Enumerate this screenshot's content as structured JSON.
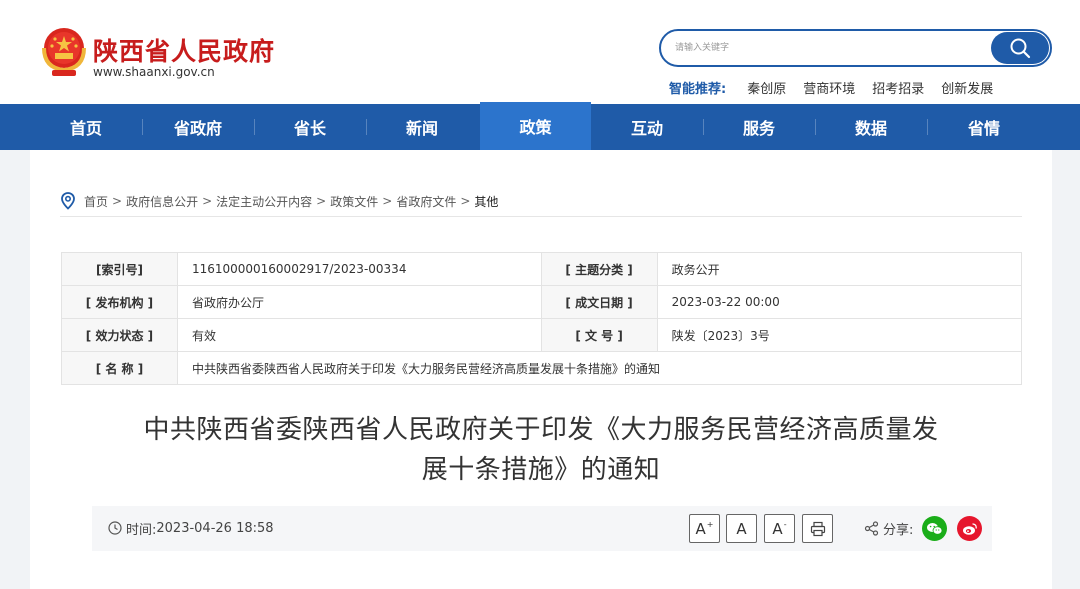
{
  "header": {
    "site_name": "陕西省人民政府",
    "site_url": "www.shaanxi.gov.cn",
    "search_placeholder": "请输入关键字",
    "recommend_label": "智能推荐:",
    "recommend_items": [
      "秦创原",
      "营商环境",
      "招考招录",
      "创新发展"
    ]
  },
  "nav": {
    "items": [
      "首页",
      "省政府",
      "省长",
      "新闻",
      "政策",
      "互动",
      "服务",
      "数据",
      "省情"
    ],
    "active": "政策"
  },
  "breadcrumb": {
    "items": [
      "首页",
      "政府信息公开",
      "法定主动公开内容",
      "政策文件",
      "省政府文件"
    ],
    "current": "其他",
    "separator": ">"
  },
  "info": {
    "index_label": "[索引号]",
    "index_value": "116100000160002917/2023-00334",
    "topic_label": "[ 主题分类 ]",
    "topic_value": "政务公开",
    "issuer_label": "[ 发布机构 ]",
    "issuer_value": "省政府办公厅",
    "date_label": "[ 成文日期 ]",
    "date_value": "2023-03-22 00:00",
    "status_label": "[ 效力状态 ]",
    "status_value": "有效",
    "docno_label": "[ 文 号 ]",
    "docno_value": "陕发〔2023〕3号",
    "name_label": "[ 名 称 ]",
    "name_value": "中共陕西省委陕西省人民政府关于印发《大力服务民营经济高质量发展十条措施》的通知"
  },
  "article": {
    "title_line1": "中共陕西省委陕西省人民政府关于印发《大力服务民营经济高质量发",
    "title_line2": "展十条措施》的通知",
    "time_label": "时间:",
    "time_value": "2023-04-26 18:58",
    "share_label": "分享:",
    "font_larger": "A",
    "font_normal": "A",
    "font_smaller": "A",
    "plus": "+",
    "minus": "-"
  },
  "colors": {
    "brand_blue": "#1f5ba8",
    "brand_red": "#c71c1c",
    "wechat_green": "#1aad19",
    "weibo_red": "#e6162d"
  }
}
